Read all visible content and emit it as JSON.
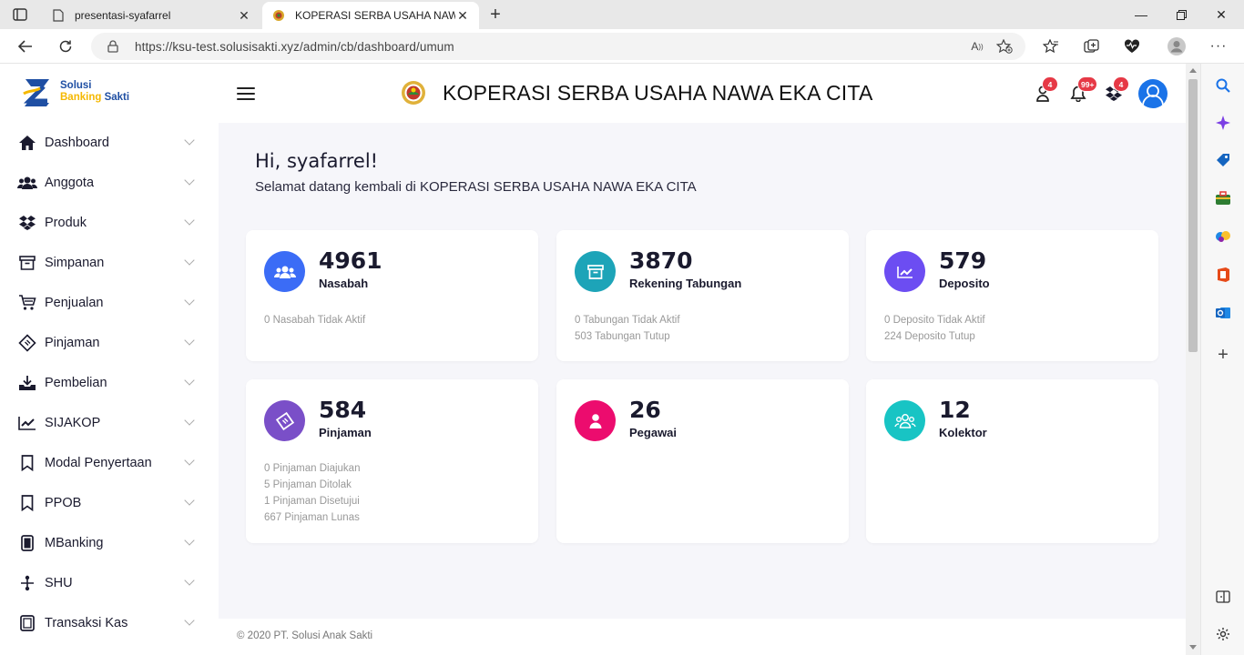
{
  "browser": {
    "tabs": [
      {
        "title": "presentasi-syafarrel",
        "active": false
      },
      {
        "title": "KOPERASI SERBA USAHA NAWA",
        "active": true
      }
    ],
    "url": "https://ksu-test.solusisakti.xyz/admin/cb/dashboard/umum"
  },
  "logo": {
    "line1": "Solusi",
    "line2a": "Banking",
    "line2b": " Sakti"
  },
  "sidebar": {
    "items": [
      {
        "label": "Dashboard",
        "icon": "home-icon"
      },
      {
        "label": "Anggota",
        "icon": "users-icon"
      },
      {
        "label": "Produk",
        "icon": "dropbox-icon"
      },
      {
        "label": "Simpanan",
        "icon": "archive-icon"
      },
      {
        "label": "Penjualan",
        "icon": "cart-icon"
      },
      {
        "label": "Pinjaman",
        "icon": "ticket-icon"
      },
      {
        "label": "Pembelian",
        "icon": "download-tray-icon"
      },
      {
        "label": "SIJAKOP",
        "icon": "chart-line-icon"
      },
      {
        "label": "Modal Penyertaan",
        "icon": "bookmark-icon"
      },
      {
        "label": "PPOB",
        "icon": "bookmark-icon"
      },
      {
        "label": "MBanking",
        "icon": "mobile-icon"
      },
      {
        "label": "SHU",
        "icon": "sitemap-icon"
      },
      {
        "label": "Transaksi Kas",
        "icon": "window-icon"
      }
    ]
  },
  "header": {
    "title": "KOPERASI SERBA USAHA NAWA EKA CITA",
    "badges": {
      "users": "4",
      "notifications": "99+",
      "products": "4"
    }
  },
  "greeting": {
    "title": "Hi, syafarrel!",
    "subtitle": "Selamat datang kembali di KOPERASI SERBA USAHA NAWA EKA CITA"
  },
  "cards": [
    {
      "value": "4961",
      "title": "Nasabah",
      "color": "#3b6cf6",
      "icon": "users-icon",
      "details": [
        "0 Nasabah Tidak Aktif"
      ]
    },
    {
      "value": "3870",
      "title": "Rekening Tabungan",
      "color": "#1da4b8",
      "icon": "archive-icon",
      "details": [
        "0 Tabungan Tidak Aktif",
        "503 Tabungan Tutup"
      ]
    },
    {
      "value": "579",
      "title": "Deposito",
      "color": "#6c4df2",
      "icon": "chart-line-icon",
      "details": [
        "0 Deposito Tidak Aktif",
        "224 Deposito Tutup"
      ]
    },
    {
      "value": "584",
      "title": "Pinjaman",
      "color": "#7a4fc8",
      "icon": "ticket-icon",
      "details": [
        "0 Pinjaman Diajukan",
        "5 Pinjaman Ditolak",
        "1 Pinjaman Disetujui",
        "667 Pinjaman Lunas"
      ]
    },
    {
      "value": "26",
      "title": "Pegawai",
      "color": "#ec0c6e",
      "icon": "user-icon",
      "details": []
    },
    {
      "value": "12",
      "title": "Kolektor",
      "color": "#18c4c4",
      "icon": "group-icon",
      "details": []
    }
  ],
  "footer": {
    "text": "© 2020 PT. Solusi Anak Sakti"
  }
}
